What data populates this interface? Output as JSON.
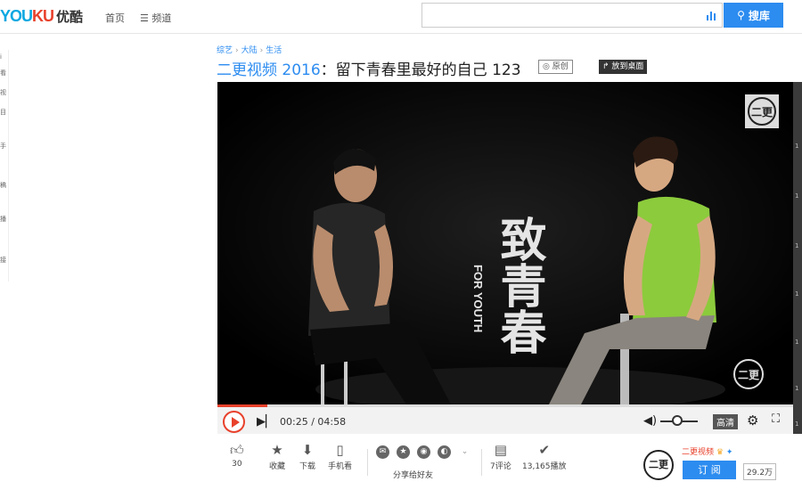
{
  "header": {
    "logo_you": "YOU",
    "logo_ku": "KU",
    "logo_cn": "优酷",
    "nav_home": "首页",
    "nav_channel": "频道",
    "search_value": "",
    "search_button": "搜库"
  },
  "left_rail": [
    "i",
    "看",
    "视",
    "目",
    "手",
    "稿",
    "播",
    "接"
  ],
  "breadcrumb": [
    "综艺",
    "大陆",
    "生活"
  ],
  "video": {
    "title_blue": "二更视频 2016",
    "title_rest": "：留下青春里最好的自己 123",
    "original_badge": "原创",
    "desktop_badge": "放到桌面",
    "overlay_title": "致青春",
    "overlay_sub": "FOR YOUTH",
    "watermark": "二更"
  },
  "controls": {
    "time": "00:25 / 04:58",
    "quality": "高清",
    "progress_fraction": 0.087,
    "volume_fraction": 0.45
  },
  "actions": {
    "like_count": "30",
    "favorite": "收藏",
    "download": "下载",
    "mobile": "手机看",
    "share_label": "分享给好友",
    "comments": "7评论",
    "plays": "13,165播放"
  },
  "channel": {
    "avatar_text": "二更",
    "name": "二更视频",
    "subscribe": "订 阅",
    "subscribers": "29.2万"
  },
  "right_strip": [
    "1",
    "1",
    "1",
    "1",
    "1",
    "1",
    "1"
  ],
  "colors": {
    "accent_blue": "#2c8cf0",
    "accent_red": "#e8412c",
    "shirt_green": "#8ccb3c"
  }
}
